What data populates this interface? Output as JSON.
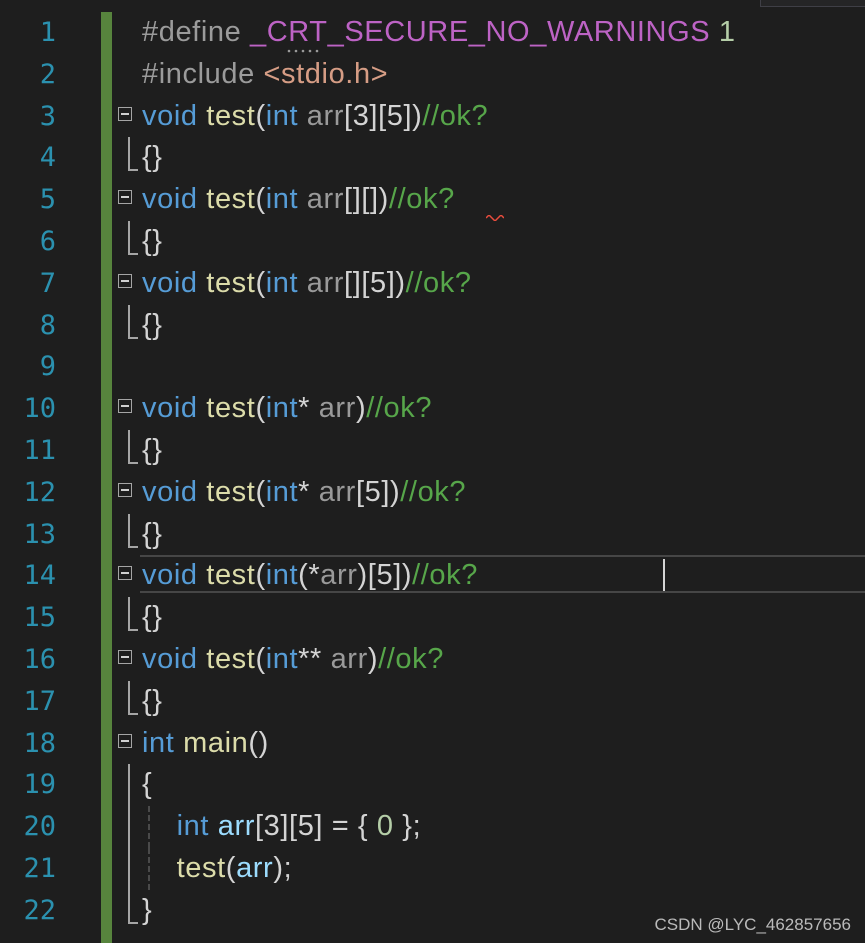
{
  "editor": {
    "watermark": "CSDN @LYC_462857656"
  },
  "lines": [
    {
      "num": "1",
      "tokens": [
        {
          "t": "#define ",
          "c": "pp"
        },
        {
          "t": "_CRT_SECURE_NO_WARNINGS",
          "c": "mac"
        },
        {
          "t": " 1",
          "c": "num"
        }
      ]
    },
    {
      "num": "2",
      "tokens": [
        {
          "t": "#include ",
          "c": "pp"
        },
        {
          "t": "<stdio.h>",
          "c": "str"
        }
      ]
    },
    {
      "num": "3",
      "fold": true,
      "tokens": [
        {
          "t": "void",
          "c": "kw"
        },
        {
          "t": " ",
          "c": "op"
        },
        {
          "t": "test",
          "c": "fn"
        },
        {
          "t": "(",
          "c": "op"
        },
        {
          "t": "int",
          "c": "kw"
        },
        {
          "t": " arr",
          "c": "par"
        },
        {
          "t": "[3][5])",
          "c": "op"
        },
        {
          "t": "//ok?",
          "c": "cm"
        }
      ]
    },
    {
      "num": "4",
      "foldEnd": true,
      "tokens": [
        {
          "t": "{}",
          "c": "op"
        }
      ]
    },
    {
      "num": "5",
      "fold": true,
      "squiggle": true,
      "tokens": [
        {
          "t": "void",
          "c": "kw"
        },
        {
          "t": " ",
          "c": "op"
        },
        {
          "t": "test",
          "c": "fn"
        },
        {
          "t": "(",
          "c": "op"
        },
        {
          "t": "int",
          "c": "kw"
        },
        {
          "t": " arr",
          "c": "par"
        },
        {
          "t": "[][])",
          "c": "op"
        },
        {
          "t": "//ok?",
          "c": "cm"
        }
      ]
    },
    {
      "num": "6",
      "foldEnd": true,
      "tokens": [
        {
          "t": "{}",
          "c": "op"
        }
      ]
    },
    {
      "num": "7",
      "fold": true,
      "tokens": [
        {
          "t": "void",
          "c": "kw"
        },
        {
          "t": " ",
          "c": "op"
        },
        {
          "t": "test",
          "c": "fn"
        },
        {
          "t": "(",
          "c": "op"
        },
        {
          "t": "int",
          "c": "kw"
        },
        {
          "t": " arr",
          "c": "par"
        },
        {
          "t": "[][5])",
          "c": "op"
        },
        {
          "t": "//ok?",
          "c": "cm"
        }
      ]
    },
    {
      "num": "8",
      "foldEnd": true,
      "tokens": [
        {
          "t": "{}",
          "c": "op"
        }
      ]
    },
    {
      "num": "9",
      "tokens": []
    },
    {
      "num": "10",
      "fold": true,
      "tokens": [
        {
          "t": "void",
          "c": "kw"
        },
        {
          "t": " ",
          "c": "op"
        },
        {
          "t": "test",
          "c": "fn"
        },
        {
          "t": "(",
          "c": "op"
        },
        {
          "t": "int",
          "c": "kw"
        },
        {
          "t": "* ",
          "c": "op"
        },
        {
          "t": "arr",
          "c": "par"
        },
        {
          "t": ")",
          "c": "op"
        },
        {
          "t": "//ok?",
          "c": "cm"
        }
      ]
    },
    {
      "num": "11",
      "foldEnd": true,
      "tokens": [
        {
          "t": "{}",
          "c": "op"
        }
      ]
    },
    {
      "num": "12",
      "fold": true,
      "tokens": [
        {
          "t": "void",
          "c": "kw"
        },
        {
          "t": " ",
          "c": "op"
        },
        {
          "t": "test",
          "c": "fn"
        },
        {
          "t": "(",
          "c": "op"
        },
        {
          "t": "int",
          "c": "kw"
        },
        {
          "t": "* ",
          "c": "op"
        },
        {
          "t": "arr",
          "c": "par"
        },
        {
          "t": "[5])",
          "c": "op"
        },
        {
          "t": "//ok?",
          "c": "cm"
        }
      ]
    },
    {
      "num": "13",
      "foldEnd": true,
      "tokens": [
        {
          "t": "{}",
          "c": "op"
        }
      ]
    },
    {
      "num": "14",
      "fold": true,
      "current": true,
      "tokens": [
        {
          "t": "void",
          "c": "kw"
        },
        {
          "t": " ",
          "c": "op"
        },
        {
          "t": "test",
          "c": "fn"
        },
        {
          "t": "(",
          "c": "op"
        },
        {
          "t": "int",
          "c": "kw"
        },
        {
          "t": "(*",
          "c": "op"
        },
        {
          "t": "arr",
          "c": "par"
        },
        {
          "t": ")[5])",
          "c": "op"
        },
        {
          "t": "//ok?",
          "c": "cm"
        }
      ]
    },
    {
      "num": "15",
      "foldEnd": true,
      "tokens": [
        {
          "t": "{}",
          "c": "op"
        }
      ]
    },
    {
      "num": "16",
      "fold": true,
      "tokens": [
        {
          "t": "void",
          "c": "kw"
        },
        {
          "t": " ",
          "c": "op"
        },
        {
          "t": "test",
          "c": "fn"
        },
        {
          "t": "(",
          "c": "op"
        },
        {
          "t": "int",
          "c": "kw"
        },
        {
          "t": "** ",
          "c": "op"
        },
        {
          "t": "arr",
          "c": "par"
        },
        {
          "t": ")",
          "c": "op"
        },
        {
          "t": "//ok?",
          "c": "cm"
        }
      ]
    },
    {
      "num": "17",
      "foldEnd": true,
      "tokens": [
        {
          "t": "{}",
          "c": "op"
        }
      ]
    },
    {
      "num": "18",
      "fold": true,
      "tokens": [
        {
          "t": "int",
          "c": "kw"
        },
        {
          "t": " ",
          "c": "op"
        },
        {
          "t": "main",
          "c": "fn"
        },
        {
          "t": "()",
          "c": "op"
        }
      ]
    },
    {
      "num": "19",
      "foldMid": true,
      "tokens": [
        {
          "t": "{",
          "c": "op"
        }
      ]
    },
    {
      "num": "20",
      "foldMid": true,
      "guide": true,
      "tokens": [
        {
          "t": "    ",
          "c": "op"
        },
        {
          "t": "int",
          "c": "kw"
        },
        {
          "t": " ",
          "c": "op"
        },
        {
          "t": "arr",
          "c": "var"
        },
        {
          "t": "[3][5] = { ",
          "c": "op"
        },
        {
          "t": "0",
          "c": "num"
        },
        {
          "t": " };",
          "c": "op"
        }
      ]
    },
    {
      "num": "21",
      "foldMid": true,
      "guide": true,
      "tokens": [
        {
          "t": "    ",
          "c": "op"
        },
        {
          "t": "test",
          "c": "fn"
        },
        {
          "t": "(",
          "c": "op"
        },
        {
          "t": "arr",
          "c": "var"
        },
        {
          "t": ");",
          "c": "op"
        }
      ]
    },
    {
      "num": "22",
      "foldEnd": true,
      "tokens": [
        {
          "t": "}",
          "c": "op"
        }
      ]
    }
  ]
}
